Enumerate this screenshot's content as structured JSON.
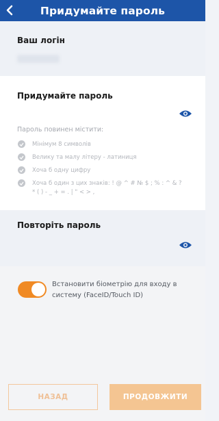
{
  "header": {
    "title": "Придумайте пароль"
  },
  "login": {
    "label": "Ваш логін"
  },
  "password": {
    "label": "Придумайте пароль",
    "requirements_title": "Пароль повинен містити:",
    "requirements": [
      "Мінімум 8 символів",
      "Велику та малу літеру - латиниця",
      "Хоча б одну цифру",
      "Хоча б один з цих знаків: ! @ ^ # № $ ; % : ^ & ? * ( ) - _ + = . | \" < > ,"
    ]
  },
  "repeat": {
    "label": "Повторіть пароль"
  },
  "biometry": {
    "label": "Встановити біометрію для входу в систему (FaceID/Touch ID)",
    "enabled": true
  },
  "buttons": {
    "back": "НАЗАД",
    "next": "ПРОДОВЖИТИ"
  },
  "colors": {
    "header": "#1d55a8",
    "accent": "#f08a24"
  }
}
